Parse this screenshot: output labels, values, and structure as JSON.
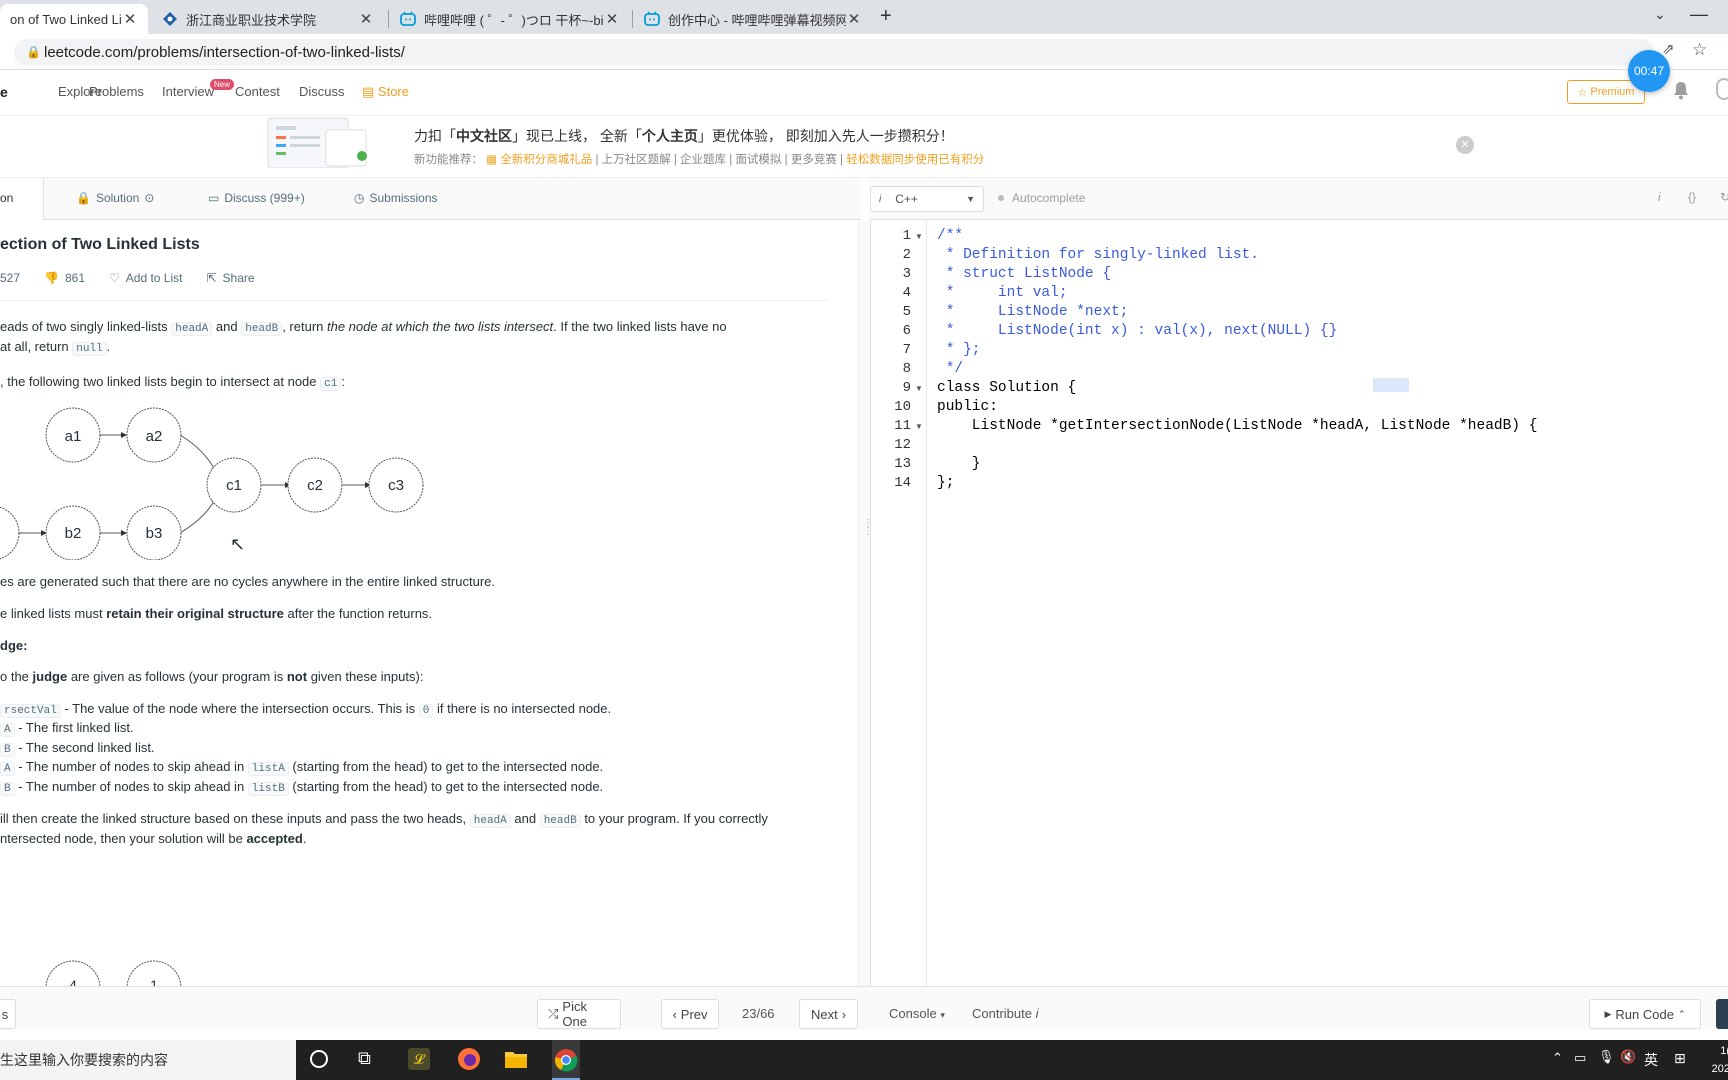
{
  "browser": {
    "tabs": [
      {
        "title": "on of Two Linked List",
        "active": true
      },
      {
        "title": "浙江商业职业技术学院",
        "active": false
      },
      {
        "title": "哔哩哔哩 ( ゜- ゜)つロ 干杯~-bili",
        "active": false
      },
      {
        "title": "创作中心 - 哔哩哔哩弹幕视频网",
        "active": false
      }
    ],
    "new_tab": "+",
    "url": "leetcode.com/problems/intersection-of-two-linked-lists/"
  },
  "nav": {
    "logo_fragment": "e",
    "items": [
      "Explore",
      "Problems",
      "Interview",
      "Contest",
      "Discuss",
      "Store"
    ],
    "interview_badge": "New",
    "premium": "Premium",
    "timer": "00:47"
  },
  "banner": {
    "line1_pre": "力扣「",
    "line1_b1": "中文社区",
    "line1_mid": "」现已上线， 全新「",
    "line1_b2": "个人主页",
    "line1_post": "」更优体验， 即刻加入先人一步攒积分！",
    "line2_label": "新功能推荐：",
    "line2_items": [
      "全新积分商城礼品",
      "上万社区题解",
      "企业题库",
      "面试模拟",
      "更多竞赛",
      "轻松数据同步使用已有积分"
    ]
  },
  "problem_tabs": {
    "description": "on",
    "solution": "Solution",
    "discuss": "Discuss (999+)",
    "submissions": "Submissions"
  },
  "problem": {
    "title": "ection of Two Linked Lists",
    "likes": "527",
    "dislikes": "861",
    "add_to_list": "Add to List",
    "share": "Share",
    "p1_a": "eads of two singly linked-lists ",
    "p1_code1": "headA",
    "p1_b": " and ",
    "p1_code2": "headB",
    "p1_c": ", return ",
    "p1_em": "the node at which the two lists intersect",
    "p1_d": ". If the two linked lists have no",
    "p2_a": "at all, return ",
    "p2_code": "null",
    "p2_b": ".",
    "p3_a": ", the following two linked lists begin to intersect at node ",
    "p3_code": "c1",
    "p3_b": ":",
    "diagram_nodes": [
      "a1",
      "a2",
      "c1",
      "c2",
      "c3",
      "b2",
      "b3"
    ],
    "diagram2_nodes": [
      "4",
      "1"
    ],
    "p4": "es are generated such that there are no cycles anywhere in the entire linked structure.",
    "p5_a": "e linked lists must ",
    "p5_b": "retain their original structure",
    "p5_c": " after the function returns.",
    "p6": "dge:",
    "p7_a": "o the ",
    "p7_b": "judge",
    "p7_c": " are given as follows (your program is ",
    "p7_d": "not",
    "p7_e": " given these inputs):",
    "l1_code": "rsectVal",
    "l1_text": " - The value of the node where the intersection occurs. This is ",
    "l1_code2": "0",
    "l1_text2": " if there is no intersected node.",
    "l2_code": "A",
    "l2_text": " - The first linked list.",
    "l3_code": "B",
    "l3_text": " - The second linked list.",
    "l4_code": "A",
    "l4_text": " - The number of nodes to skip ahead in ",
    "l4_code2": "listA",
    "l4_text2": " (starting from the head) to get to the intersected node.",
    "l5_code": "B",
    "l5_text": " - The number of nodes to skip ahead in ",
    "l5_code2": "listB",
    "l5_text2": " (starting from the head) to get to the intersected node.",
    "p8_a": "ill then create the linked structure based on these inputs and pass the two heads, ",
    "p8_code1": "headA",
    "p8_b": " and ",
    "p8_code2": "headB",
    "p8_c": " to your program. If you correctly",
    "p9_a": "ntersected node, then your solution will be ",
    "p9_b": "accepted",
    "p9_c": "."
  },
  "editor": {
    "language": "C++",
    "autocomplete": "Autocomplete",
    "lines": [
      "/**",
      " * Definition for singly-linked list.",
      " * struct ListNode {",
      " *     int val;",
      " *     ListNode *next;",
      " *     ListNode(int x) : val(x), next(NULL) {}",
      " * };",
      " */",
      "class Solution {",
      "public:",
      "    ListNode *getIntersectionNode(ListNode *headA, ListNode *headB) {",
      "        ",
      "    }",
      "};"
    ],
    "line_numbers": [
      "1",
      "2",
      "3",
      "4",
      "5",
      "6",
      "7",
      "8",
      "9",
      "10",
      "11",
      "12",
      "13",
      "14"
    ]
  },
  "bottom": {
    "left_fragment": "s",
    "pick_one": "Pick One",
    "prev": "Prev",
    "page": "23/66",
    "next": "Next",
    "console": "Console",
    "contribute": "Contribute",
    "run_code": "Run Code"
  },
  "taskbar": {
    "search_placeholder": "生这里输入你要搜索的内容",
    "ime": "英",
    "clock_fragment_1": "1(",
    "clock_fragment_2": "202"
  }
}
